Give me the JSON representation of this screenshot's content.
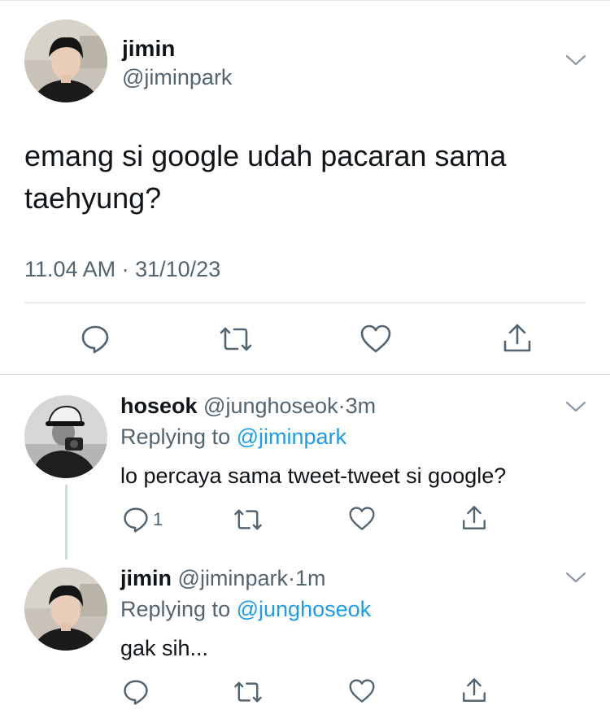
{
  "main_tweet": {
    "display_name": "jimin",
    "handle": "@jiminpark",
    "text_line1": "emang si google udah pacaran sama",
    "text_line2": "taehyung?",
    "time": "11.04 AM",
    "separator": "·",
    "date": "31/10/23"
  },
  "replies": [
    {
      "display_name": "hoseok",
      "handle": "@junghoseok",
      "dot": "·",
      "age": "3m",
      "replying_prefix": "Replying to",
      "replying_to": "@jiminpark",
      "text": "lo percaya sama tweet-tweet si google?",
      "reply_count": "1"
    },
    {
      "display_name": "jimin",
      "handle": "@jiminpark",
      "dot": "·",
      "age": "1m",
      "replying_prefix": "Replying to",
      "replying_to": "@junghoseok",
      "text": "gak sih...",
      "reply_count": ""
    }
  ],
  "icons": {
    "reply": "reply-icon",
    "retweet": "retweet-icon",
    "like": "like-icon",
    "share": "share-icon",
    "more": "chevron-down-icon"
  },
  "colors": {
    "text": "#0f1419",
    "muted": "#536471",
    "link": "#1d9bf0",
    "divider": "#d9dde1"
  }
}
